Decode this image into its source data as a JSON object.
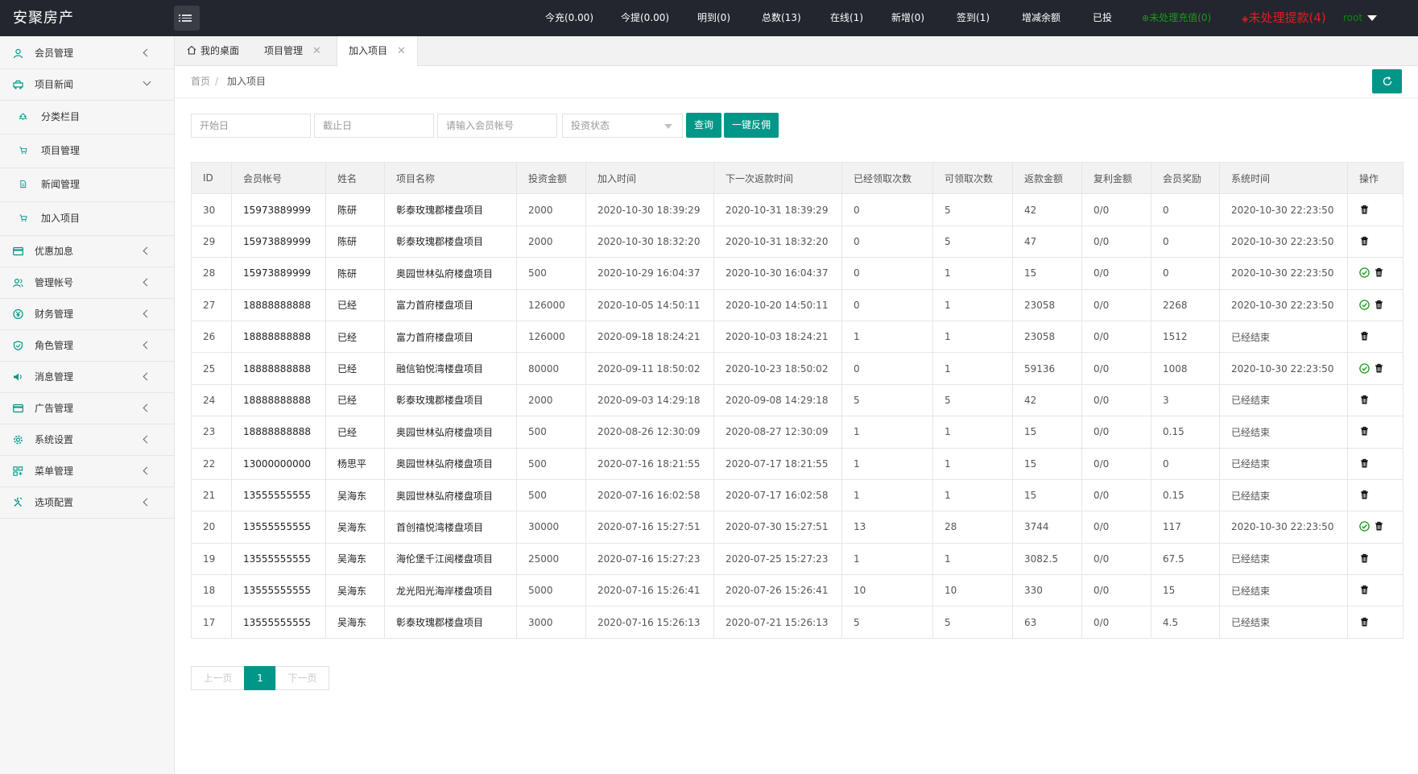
{
  "brand": "安聚房产",
  "topbar": {
    "items": [
      {
        "label": "今充(0.00)",
        "kind": "normal"
      },
      {
        "label": "今提(0.00)",
        "kind": "normal"
      },
      {
        "label": "明到(0)",
        "kind": "normal"
      },
      {
        "label": "总数(13)",
        "kind": "normal"
      },
      {
        "label": "在线(1)",
        "kind": "normal"
      },
      {
        "label": "新增(0)",
        "kind": "normal"
      },
      {
        "label": "签到(1)",
        "kind": "normal"
      },
      {
        "label": "增减余额",
        "kind": "normal"
      },
      {
        "label": "已投",
        "kind": "normal"
      },
      {
        "label": "未处理充值(0)",
        "kind": "green"
      },
      {
        "label": "未处理提款(4)",
        "kind": "red"
      }
    ],
    "user": "root"
  },
  "sidebar": {
    "items": [
      {
        "label": "会员管理",
        "icon": "user-icon",
        "arrow": "left",
        "sub": false
      },
      {
        "label": "项目新闻",
        "icon": "car-icon",
        "arrow": "down",
        "sub": false
      },
      {
        "label": "分类栏目",
        "icon": "tree-icon",
        "arrow": "",
        "sub": true
      },
      {
        "label": "项目管理",
        "icon": "cart-icon",
        "arrow": "",
        "sub": true
      },
      {
        "label": "新闻管理",
        "icon": "file-icon",
        "arrow": "",
        "sub": true
      },
      {
        "label": "加入项目",
        "icon": "cart-icon",
        "arrow": "",
        "sub": true
      },
      {
        "label": "优惠加息",
        "icon": "card-icon",
        "arrow": "left",
        "sub": false
      },
      {
        "label": "管理帐号",
        "icon": "users-icon",
        "arrow": "left",
        "sub": false
      },
      {
        "label": "财务管理",
        "icon": "yen-icon",
        "arrow": "left",
        "sub": false
      },
      {
        "label": "角色管理",
        "icon": "shield-icon",
        "arrow": "left",
        "sub": false
      },
      {
        "label": "消息管理",
        "icon": "speaker-icon",
        "arrow": "left",
        "sub": false
      },
      {
        "label": "广告管理",
        "icon": "card-icon",
        "arrow": "left",
        "sub": false
      },
      {
        "label": "系统设置",
        "icon": "gear-icon",
        "arrow": "left",
        "sub": false
      },
      {
        "label": "菜单管理",
        "icon": "grid-icon",
        "arrow": "left",
        "sub": false
      },
      {
        "label": "选项配置",
        "icon": "tools-icon",
        "arrow": "left",
        "sub": false
      }
    ]
  },
  "tabs": [
    {
      "label": "我的桌面",
      "closable": false,
      "active": false
    },
    {
      "label": "项目管理",
      "closable": true,
      "active": false
    },
    {
      "label": "加入项目",
      "closable": true,
      "active": true
    }
  ],
  "breadcrumb": {
    "home": "首页",
    "sep": "/",
    "current": "加入项目"
  },
  "filters": {
    "start_placeholder": "开始日",
    "end_placeholder": "截止日",
    "account_placeholder": "请输入会员帐号",
    "status_placeholder": "投资状态",
    "search_label": "查询",
    "rebate_label": "一键反佣"
  },
  "table": {
    "columns": [
      "ID",
      "会员帐号",
      "姓名",
      "项目名称",
      "投资金额",
      "加入时间",
      "下一次返款时间",
      "已经领取次数",
      "可领取次数",
      "返款金额",
      "复利金额",
      "会员奖励",
      "系统时间",
      "操作"
    ],
    "rows": [
      {
        "id": "30",
        "account": "15973889999",
        "name": "陈研",
        "project": "彰泰玫瑰郡楼盘项目",
        "amount": "2000",
        "join_time": "2020-10-30 18:39:29",
        "next_time": "2020-10-31 18:39:29",
        "received": "0",
        "remaining": "5",
        "refund": "42",
        "compound": "0/0",
        "reward": "0",
        "sys_time": "2020-10-30 22:23:50",
        "confirm": false
      },
      {
        "id": "29",
        "account": "15973889999",
        "name": "陈研",
        "project": "彰泰玫瑰郡楼盘项目",
        "amount": "2000",
        "join_time": "2020-10-30 18:32:20",
        "next_time": "2020-10-31 18:32:20",
        "received": "0",
        "remaining": "5",
        "refund": "47",
        "compound": "0/0",
        "reward": "0",
        "sys_time": "2020-10-30 22:23:50",
        "confirm": false
      },
      {
        "id": "28",
        "account": "15973889999",
        "name": "陈研",
        "project": "奥园世林弘府楼盘项目",
        "amount": "500",
        "join_time": "2020-10-29 16:04:37",
        "next_time": "2020-10-30 16:04:37",
        "received": "0",
        "remaining": "1",
        "refund": "15",
        "compound": "0/0",
        "reward": "0",
        "sys_time": "2020-10-30 22:23:50",
        "confirm": true
      },
      {
        "id": "27",
        "account": "18888888888",
        "name": "已经",
        "project": "富力首府楼盘项目",
        "amount": "126000",
        "join_time": "2020-10-05 14:50:11",
        "next_time": "2020-10-20 14:50:11",
        "received": "0",
        "remaining": "1",
        "refund": "23058",
        "compound": "0/0",
        "reward": "2268",
        "sys_time": "2020-10-30 22:23:50",
        "confirm": true
      },
      {
        "id": "26",
        "account": "18888888888",
        "name": "已经",
        "project": "富力首府楼盘项目",
        "amount": "126000",
        "join_time": "2020-09-18 18:24:21",
        "next_time": "2020-10-03 18:24:21",
        "received": "1",
        "remaining": "1",
        "refund": "23058",
        "compound": "0/0",
        "reward": "1512",
        "sys_time": "已经结束",
        "confirm": false
      },
      {
        "id": "25",
        "account": "18888888888",
        "name": "已经",
        "project": "融信铂悦湾楼盘项目",
        "amount": "80000",
        "join_time": "2020-09-11 18:50:02",
        "next_time": "2020-10-23 18:50:02",
        "received": "0",
        "remaining": "1",
        "refund": "59136",
        "compound": "0/0",
        "reward": "1008",
        "sys_time": "2020-10-30 22:23:50",
        "confirm": true
      },
      {
        "id": "24",
        "account": "18888888888",
        "name": "已经",
        "project": "彰泰玫瑰郡楼盘项目",
        "amount": "2000",
        "join_time": "2020-09-03 14:29:18",
        "next_time": "2020-09-08 14:29:18",
        "received": "5",
        "remaining": "5",
        "refund": "42",
        "compound": "0/0",
        "reward": "3",
        "sys_time": "已经结束",
        "confirm": false
      },
      {
        "id": "23",
        "account": "18888888888",
        "name": "已经",
        "project": "奥园世林弘府楼盘项目",
        "amount": "500",
        "join_time": "2020-08-26 12:30:09",
        "next_time": "2020-08-27 12:30:09",
        "received": "1",
        "remaining": "1",
        "refund": "15",
        "compound": "0/0",
        "reward": "0.15",
        "sys_time": "已经结束",
        "confirm": false
      },
      {
        "id": "22",
        "account": "13000000000",
        "name": "杨思平",
        "project": "奥园世林弘府楼盘项目",
        "amount": "500",
        "join_time": "2020-07-16 18:21:55",
        "next_time": "2020-07-17 18:21:55",
        "received": "1",
        "remaining": "1",
        "refund": "15",
        "compound": "0/0",
        "reward": "0",
        "sys_time": "已经结束",
        "confirm": false
      },
      {
        "id": "21",
        "account": "13555555555",
        "name": "吴海东",
        "project": "奥园世林弘府楼盘项目",
        "amount": "500",
        "join_time": "2020-07-16 16:02:58",
        "next_time": "2020-07-17 16:02:58",
        "received": "1",
        "remaining": "1",
        "refund": "15",
        "compound": "0/0",
        "reward": "0.15",
        "sys_time": "已经结束",
        "confirm": false
      },
      {
        "id": "20",
        "account": "13555555555",
        "name": "吴海东",
        "project": "首创禧悦湾楼盘项目",
        "amount": "30000",
        "join_time": "2020-07-16 15:27:51",
        "next_time": "2020-07-30 15:27:51",
        "received": "13",
        "remaining": "28",
        "refund": "3744",
        "compound": "0/0",
        "reward": "117",
        "sys_time": "2020-10-30 22:23:50",
        "confirm": true
      },
      {
        "id": "19",
        "account": "13555555555",
        "name": "吴海东",
        "project": "海伦堡千江阅楼盘项目",
        "amount": "25000",
        "join_time": "2020-07-16 15:27:23",
        "next_time": "2020-07-25 15:27:23",
        "received": "1",
        "remaining": "1",
        "refund": "3082.5",
        "compound": "0/0",
        "reward": "67.5",
        "sys_time": "已经结束",
        "confirm": false
      },
      {
        "id": "18",
        "account": "13555555555",
        "name": "吴海东",
        "project": "龙光阳光海岸楼盘项目",
        "amount": "5000",
        "join_time": "2020-07-16 15:26:41",
        "next_time": "2020-07-26 15:26:41",
        "received": "10",
        "remaining": "10",
        "refund": "330",
        "compound": "0/0",
        "reward": "15",
        "sys_time": "已经结束",
        "confirm": false
      },
      {
        "id": "17",
        "account": "13555555555",
        "name": "吴海东",
        "project": "彰泰玫瑰郡楼盘项目",
        "amount": "3000",
        "join_time": "2020-07-16 15:26:13",
        "next_time": "2020-07-21 15:26:13",
        "received": "5",
        "remaining": "5",
        "refund": "63",
        "compound": "0/0",
        "reward": "4.5",
        "sys_time": "已经结束",
        "confirm": false
      }
    ]
  },
  "pager": {
    "prev": "上一页",
    "current": "1",
    "next": "下一页"
  },
  "colors": {
    "accent": "#009688",
    "topbar": "#23262e",
    "alert_red": "#e01e1e",
    "ok_green": "#1a9a1a"
  }
}
